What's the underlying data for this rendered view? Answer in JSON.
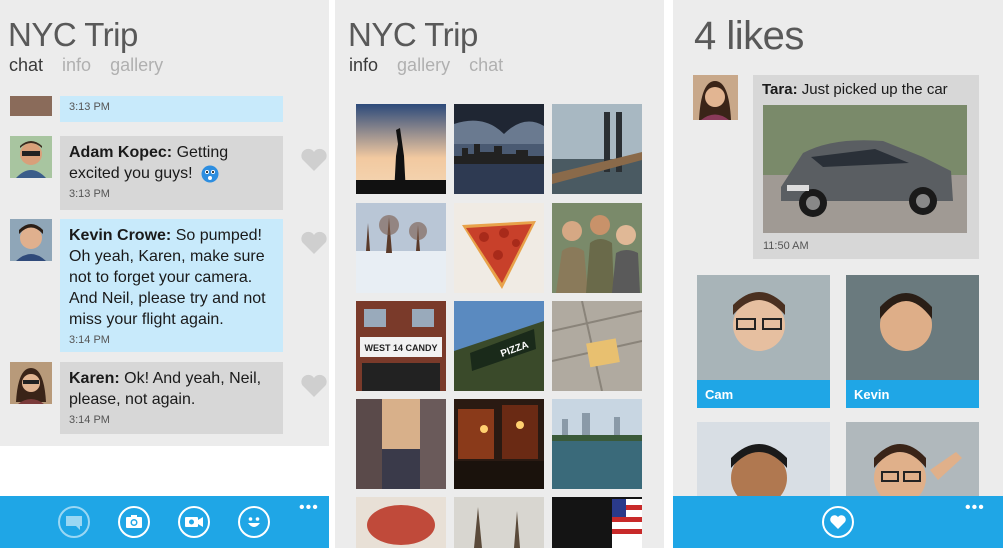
{
  "chat_screen": {
    "title": "NYC Trip",
    "pivots": [
      "chat",
      "info",
      "gallery"
    ],
    "top_partial_time": "3:13 PM",
    "messages": [
      {
        "author": "Adam Kopec:",
        "text": " Getting excited you guys!",
        "time": "3:13 PM",
        "style": "gray"
      },
      {
        "author": "Kevin Crowe:",
        "text": " So pumped! Oh yeah, Karen, make sure not to forget your camera. And Neil, please try and not miss your flight again.",
        "time": "3:14 PM",
        "style": "blue"
      },
      {
        "author": "Karen:",
        "text": " Ok! And yeah, Neil, please, not again.",
        "time": "3:14 PM",
        "style": "gray"
      }
    ],
    "appbar_icons": [
      "chat-icon",
      "camera-icon",
      "video-icon",
      "smiley-icon"
    ],
    "more": "•••"
  },
  "gallery_screen": {
    "title": "NYC Trip",
    "pivots": [
      "info",
      "gallery",
      "chat"
    ],
    "photos": [
      "statue-of-liberty-photo",
      "city-skyline-photo",
      "bridge-photo",
      "snowy-park-photo",
      "pizza-photo",
      "friends-photo",
      "candy-store-photo",
      "pizza-sign-photo",
      "sidewalk-photo",
      "city-street-photo",
      "night-street-photo",
      "lake-photo",
      "food-photo",
      "tree-photo",
      "flag-photo"
    ]
  },
  "likes_screen": {
    "title": "4 likes",
    "post_author": "Tara:",
    "post_text": " Just picked up the car",
    "post_time": "11:50 AM",
    "likers": [
      "Cam",
      "Kevin",
      "",
      ""
    ],
    "more": "•••"
  },
  "colors": {
    "accent": "#1fa6e6",
    "panel_bg": "#ececec",
    "bubble_gray": "#d7d7d7",
    "bubble_blue": "#c8eafb"
  }
}
